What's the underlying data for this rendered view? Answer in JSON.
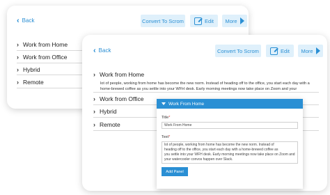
{
  "toolbar": {
    "back_label": "Back",
    "convert_label": "Convert To Scrom",
    "edit_label": "Edit",
    "more_label": "More"
  },
  "back_window": {
    "items": [
      {
        "label": "Work from Home"
      },
      {
        "label": "Work from Office"
      },
      {
        "label": "Hybrid"
      },
      {
        "label": "Remote"
      }
    ]
  },
  "front_window": {
    "items": [
      {
        "label": "Work from Home"
      },
      {
        "label": "Work from Office"
      },
      {
        "label": "Hybrid"
      },
      {
        "label": "Remote"
      }
    ],
    "expanded_text_line1": "lot of people, working from home has become the new norm. Instead of heading off to the office, you start each day with a",
    "expanded_text_line2": "home-brewed coffee as you settle into your WFH desk. Early morning meetings now take place on Zoom and your"
  },
  "panel": {
    "header": "Work From Home",
    "title_label": "Title",
    "title_value": "Work From Home",
    "text_label": "Text",
    "text_value_lines": [
      "lot of people, working from home has become the new norm. Instead of",
      "heading off to the office, you start each day with a home-brewed coffee as",
      "you settle into your WFH desk. Early morning meetings now take place on Zoom and",
      "your watercooler convos happen over Slack."
    ],
    "add_button": "Add Panel"
  },
  "colors": {
    "accent": "#2a8fd4",
    "button_bg": "#dff0fb",
    "required": "#d33333"
  }
}
